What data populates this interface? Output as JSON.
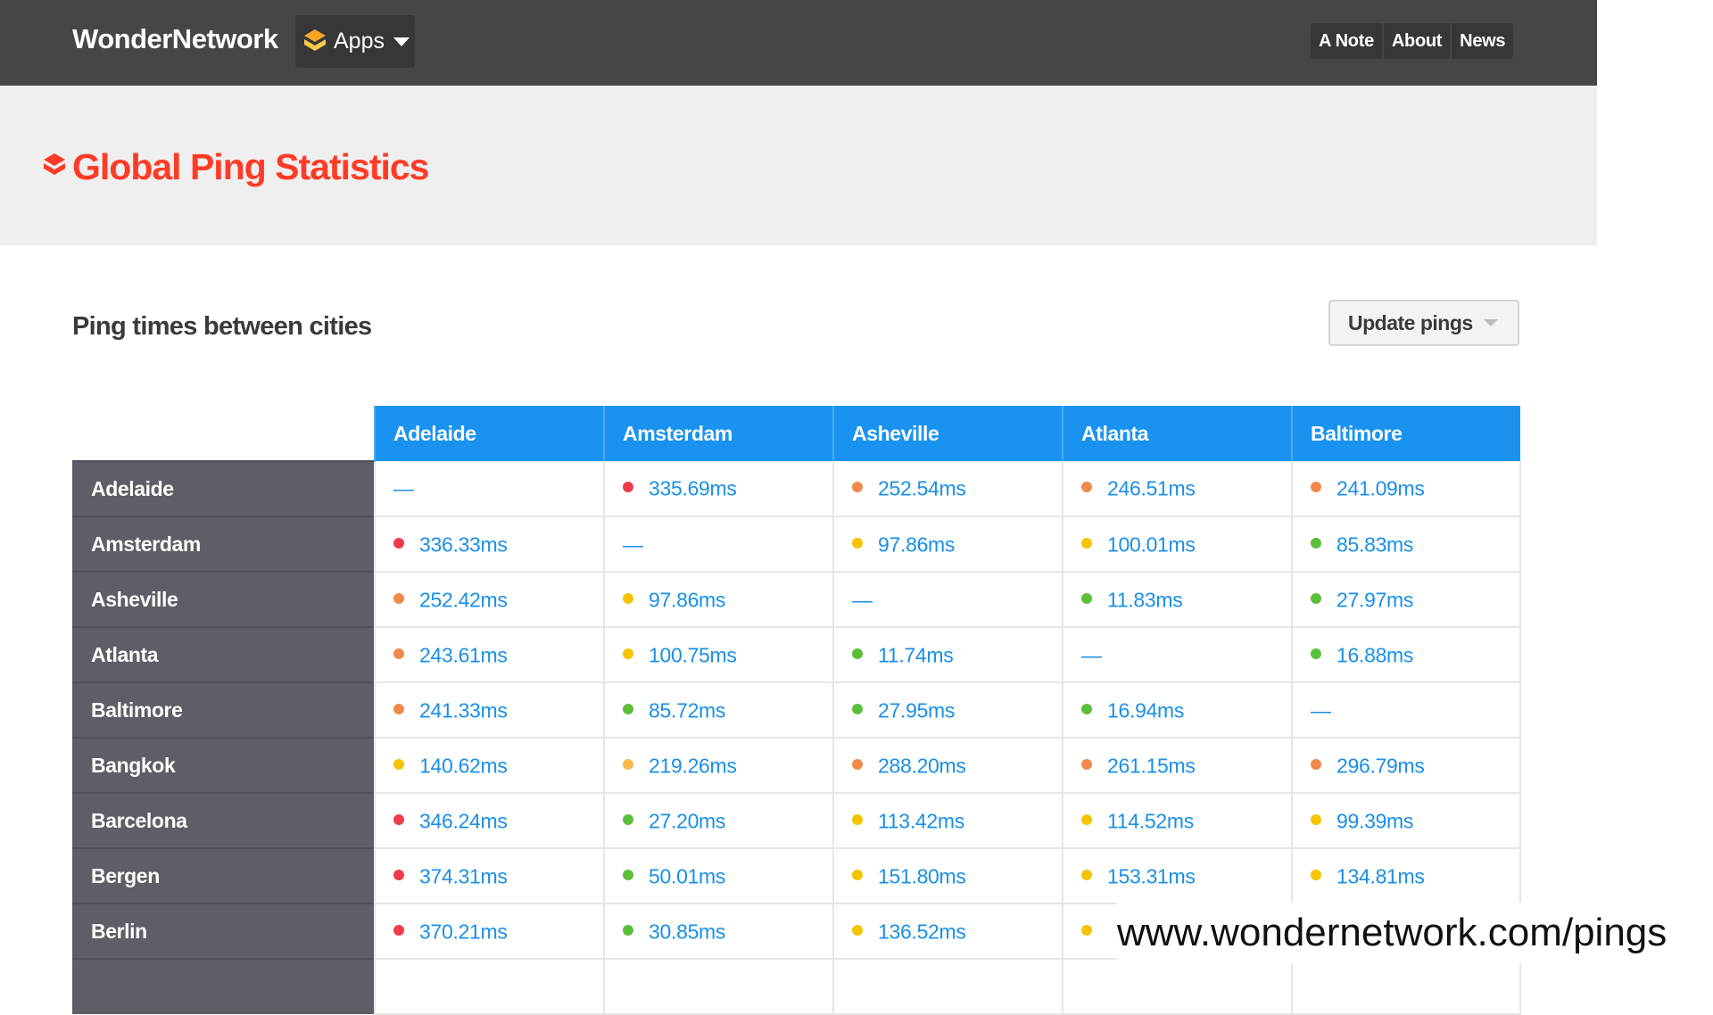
{
  "navbar": {
    "brand": "WonderNetwork",
    "apps_label": "Apps",
    "links": [
      "A Note",
      "About",
      "News"
    ]
  },
  "banner": {
    "title": "Global Ping Statistics"
  },
  "section": {
    "title": "Ping times between cities",
    "update_label": "Update pings"
  },
  "colors": {
    "red": "#ef3b4a",
    "orange": "#f08a4a",
    "yellow": "#f5c400",
    "light-orange": "#f7b94c",
    "green": "#5cbf3a",
    "navbar_bg": "#464649",
    "title_red": "#ff3b26",
    "header_blue": "#1a93f0",
    "rowhead_gray": "#5d5e66",
    "link_blue": "#1a8fe8"
  },
  "table": {
    "columns": [
      "Adelaide",
      "Amsterdam",
      "Asheville",
      "Atlanta",
      "Baltimore"
    ],
    "rows": [
      {
        "city": "Adelaide",
        "cells": [
          {
            "value": "—"
          },
          {
            "value": "335.69ms",
            "dot": "red"
          },
          {
            "value": "252.54ms",
            "dot": "orange"
          },
          {
            "value": "246.51ms",
            "dot": "orange"
          },
          {
            "value": "241.09ms",
            "dot": "orange"
          }
        ]
      },
      {
        "city": "Amsterdam",
        "cells": [
          {
            "value": "336.33ms",
            "dot": "red"
          },
          {
            "value": "—"
          },
          {
            "value": "97.86ms",
            "dot": "yellow"
          },
          {
            "value": "100.01ms",
            "dot": "yellow"
          },
          {
            "value": "85.83ms",
            "dot": "green"
          }
        ]
      },
      {
        "city": "Asheville",
        "cells": [
          {
            "value": "252.42ms",
            "dot": "orange"
          },
          {
            "value": "97.86ms",
            "dot": "yellow"
          },
          {
            "value": "—"
          },
          {
            "value": "11.83ms",
            "dot": "green"
          },
          {
            "value": "27.97ms",
            "dot": "green"
          }
        ]
      },
      {
        "city": "Atlanta",
        "cells": [
          {
            "value": "243.61ms",
            "dot": "orange"
          },
          {
            "value": "100.75ms",
            "dot": "yellow"
          },
          {
            "value": "11.74ms",
            "dot": "green"
          },
          {
            "value": "—"
          },
          {
            "value": "16.88ms",
            "dot": "green"
          }
        ]
      },
      {
        "city": "Baltimore",
        "cells": [
          {
            "value": "241.33ms",
            "dot": "orange"
          },
          {
            "value": "85.72ms",
            "dot": "green"
          },
          {
            "value": "27.95ms",
            "dot": "green"
          },
          {
            "value": "16.94ms",
            "dot": "green"
          },
          {
            "value": "—"
          }
        ]
      },
      {
        "city": "Bangkok",
        "cells": [
          {
            "value": "140.62ms",
            "dot": "yellow"
          },
          {
            "value": "219.26ms",
            "dot": "light-orange"
          },
          {
            "value": "288.20ms",
            "dot": "orange"
          },
          {
            "value": "261.15ms",
            "dot": "orange"
          },
          {
            "value": "296.79ms",
            "dot": "orange"
          }
        ]
      },
      {
        "city": "Barcelona",
        "cells": [
          {
            "value": "346.24ms",
            "dot": "red"
          },
          {
            "value": "27.20ms",
            "dot": "green"
          },
          {
            "value": "113.42ms",
            "dot": "yellow"
          },
          {
            "value": "114.52ms",
            "dot": "yellow"
          },
          {
            "value": "99.39ms",
            "dot": "yellow"
          }
        ]
      },
      {
        "city": "Bergen",
        "cells": [
          {
            "value": "374.31ms",
            "dot": "red"
          },
          {
            "value": "50.01ms",
            "dot": "green"
          },
          {
            "value": "151.80ms",
            "dot": "yellow"
          },
          {
            "value": "153.31ms",
            "dot": "yellow"
          },
          {
            "value": "134.81ms",
            "dot": "yellow"
          }
        ]
      },
      {
        "city": "Berlin",
        "cells": [
          {
            "value": "370.21ms",
            "dot": "red"
          },
          {
            "value": "30.85ms",
            "dot": "green"
          },
          {
            "value": "136.52ms",
            "dot": "yellow"
          },
          {
            "value": "",
            "dot": "yellow"
          },
          {
            "value": ""
          }
        ]
      },
      {
        "city": "",
        "cells": [
          {
            "value": ""
          },
          {
            "value": ""
          },
          {
            "value": ""
          },
          {
            "value": ""
          },
          {
            "value": ""
          }
        ]
      }
    ]
  },
  "watermark": "www.wondernetwork.com/pings"
}
